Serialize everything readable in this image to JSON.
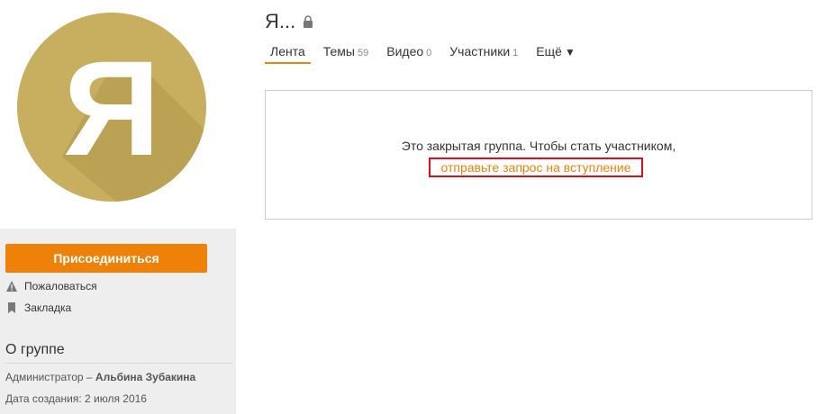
{
  "group": {
    "title": "Я...",
    "avatar_letter": "Я",
    "avatar_color": "#c8ae5f",
    "lock_icon": "lock-icon"
  },
  "tabs": [
    {
      "label": "Лента",
      "count": "",
      "active": true
    },
    {
      "label": "Темы",
      "count": "59"
    },
    {
      "label": "Видео",
      "count": "0"
    },
    {
      "label": "Участники",
      "count": "1"
    },
    {
      "label": "Ещё",
      "arrow": "▼"
    }
  ],
  "sidebar": {
    "join_label": "Присоединиться",
    "report_label": "Пожаловаться",
    "bookmark_label": "Закладка",
    "about_title": "О группе",
    "admin_prefix": "Администратор – ",
    "admin_name": "Альбина Зубакина",
    "created": "Дата создания: 2 июля 2016"
  },
  "notice": {
    "text": "Это закрытая группа. Чтобы стать участником,",
    "link_label": "отправьте запрос на вступление"
  },
  "colors": {
    "accent": "#ee8208",
    "highlight_border": "#d80f1c",
    "sidebar_bg": "#eeeeee"
  }
}
